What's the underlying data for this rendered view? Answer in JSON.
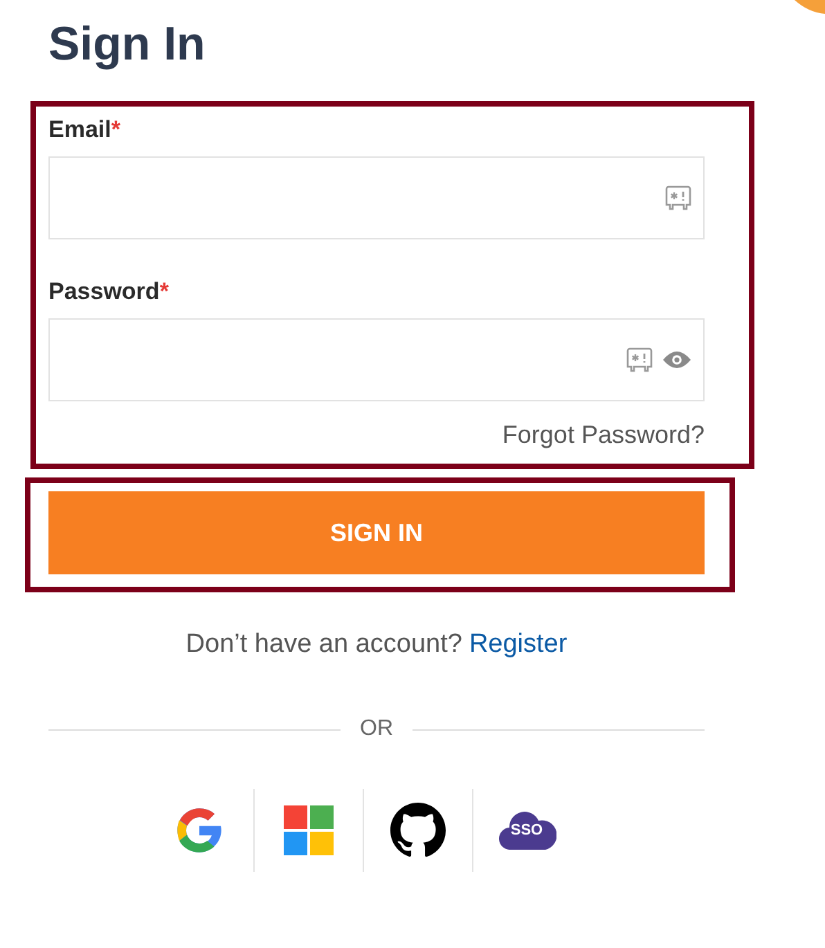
{
  "title": "Sign In",
  "fields": [
    {
      "kind": "email",
      "label": "Email",
      "required_mark": "*"
    },
    {
      "kind": "password",
      "label": "Password",
      "required_mark": "*"
    }
  ],
  "forgot_link": "Forgot Password?",
  "submit_button": "SIGN IN",
  "register": {
    "prompt": "Don’t have an account?",
    "link": "Register"
  },
  "divider_text": "OR",
  "providers": [
    {
      "kind": "google"
    },
    {
      "kind": "microsoft"
    },
    {
      "kind": "github"
    },
    {
      "kind": "sso",
      "label": "SSO"
    }
  ]
}
